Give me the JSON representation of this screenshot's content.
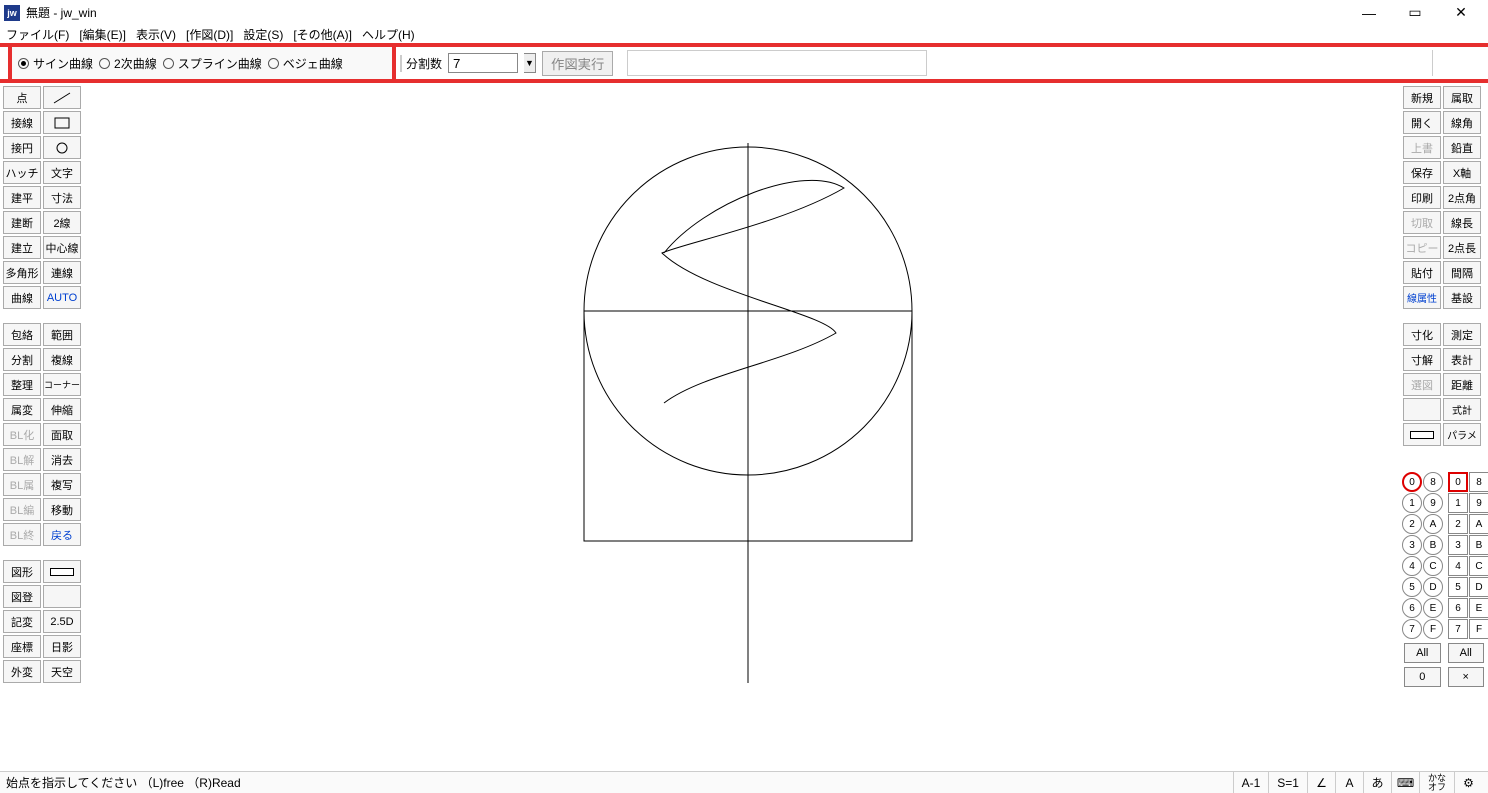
{
  "window": {
    "icon": "jw",
    "title": "無題 - jw_win"
  },
  "menu": [
    "ファイル(F)",
    "[編集(E)]",
    "表示(V)",
    "[作図(D)]",
    "設定(S)",
    "[その他(A)]",
    "ヘルプ(H)"
  ],
  "options": {
    "radios": [
      {
        "label": "サイン曲線",
        "checked": true
      },
      {
        "label": "2次曲線",
        "checked": false
      },
      {
        "label": "スプライン曲線",
        "checked": false
      },
      {
        "label": "ベジェ曲線",
        "checked": false
      }
    ],
    "div_label": "分割数",
    "div_value": "7",
    "exec_label": "作図実行"
  },
  "left_tools": [
    [
      "点",
      "line-icon"
    ],
    [
      "接線",
      "rect-icon"
    ],
    [
      "接円",
      "circle-icon"
    ],
    [
      "ハッチ",
      "文字"
    ],
    [
      "建平",
      "寸法"
    ],
    [
      "建断",
      "2線"
    ],
    [
      "建立",
      "中心線"
    ],
    [
      "多角形",
      "連線"
    ],
    [
      "曲線",
      "AUTO"
    ],
    [
      "spacer",
      ""
    ],
    [
      "包絡",
      "範囲"
    ],
    [
      "分割",
      "複線"
    ],
    [
      "整理",
      "コーナー"
    ],
    [
      "属変",
      "伸縮"
    ],
    [
      "BL化",
      "面取"
    ],
    [
      "BL解",
      "消去"
    ],
    [
      "BL属",
      "複写"
    ],
    [
      "BL編",
      "移動"
    ],
    [
      "BL終",
      "戻る"
    ],
    [
      "spacer",
      ""
    ],
    [
      "図形",
      "swatch"
    ],
    [
      "図登",
      ""
    ],
    [
      "記変",
      "2.5D"
    ],
    [
      "座標",
      "日影"
    ],
    [
      "外変",
      "天空"
    ]
  ],
  "right_tools": [
    [
      "新規",
      "属取"
    ],
    [
      "開く",
      "線角"
    ],
    [
      "上書",
      "鉛直"
    ],
    [
      "保存",
      "X軸"
    ],
    [
      "印刷",
      "2点角"
    ],
    [
      "切取",
      "線長"
    ],
    [
      "コピー",
      "2点長"
    ],
    [
      "貼付",
      "間隔"
    ],
    [
      "線属性",
      "基設"
    ],
    [
      "spacer",
      ""
    ],
    [
      "寸化",
      "測定"
    ],
    [
      "寸解",
      "表計"
    ],
    [
      "選図",
      "距離"
    ],
    [
      "",
      "式計"
    ],
    [
      "swatch",
      "パラメ"
    ]
  ],
  "layers": {
    "left_circ": [
      "0",
      "1",
      "2",
      "3",
      "4",
      "5",
      "6",
      "7"
    ],
    "left_circ2": [
      "8",
      "9",
      "A",
      "B",
      "C",
      "D",
      "E",
      "F"
    ],
    "right_sq": [
      "0",
      "1",
      "2",
      "3",
      "4",
      "5",
      "6",
      "7"
    ],
    "right_sq2": [
      "8",
      "9",
      "A",
      "B",
      "C",
      "D",
      "E",
      "F"
    ],
    "bottom_left": [
      "All",
      "0"
    ],
    "bottom_right": [
      "All",
      "×"
    ]
  },
  "status": {
    "message": "始点を指示してください （L)free （R)Read",
    "scale_a": "A-1",
    "scale_s": "S=1",
    "kana": "かな\nオフ"
  }
}
